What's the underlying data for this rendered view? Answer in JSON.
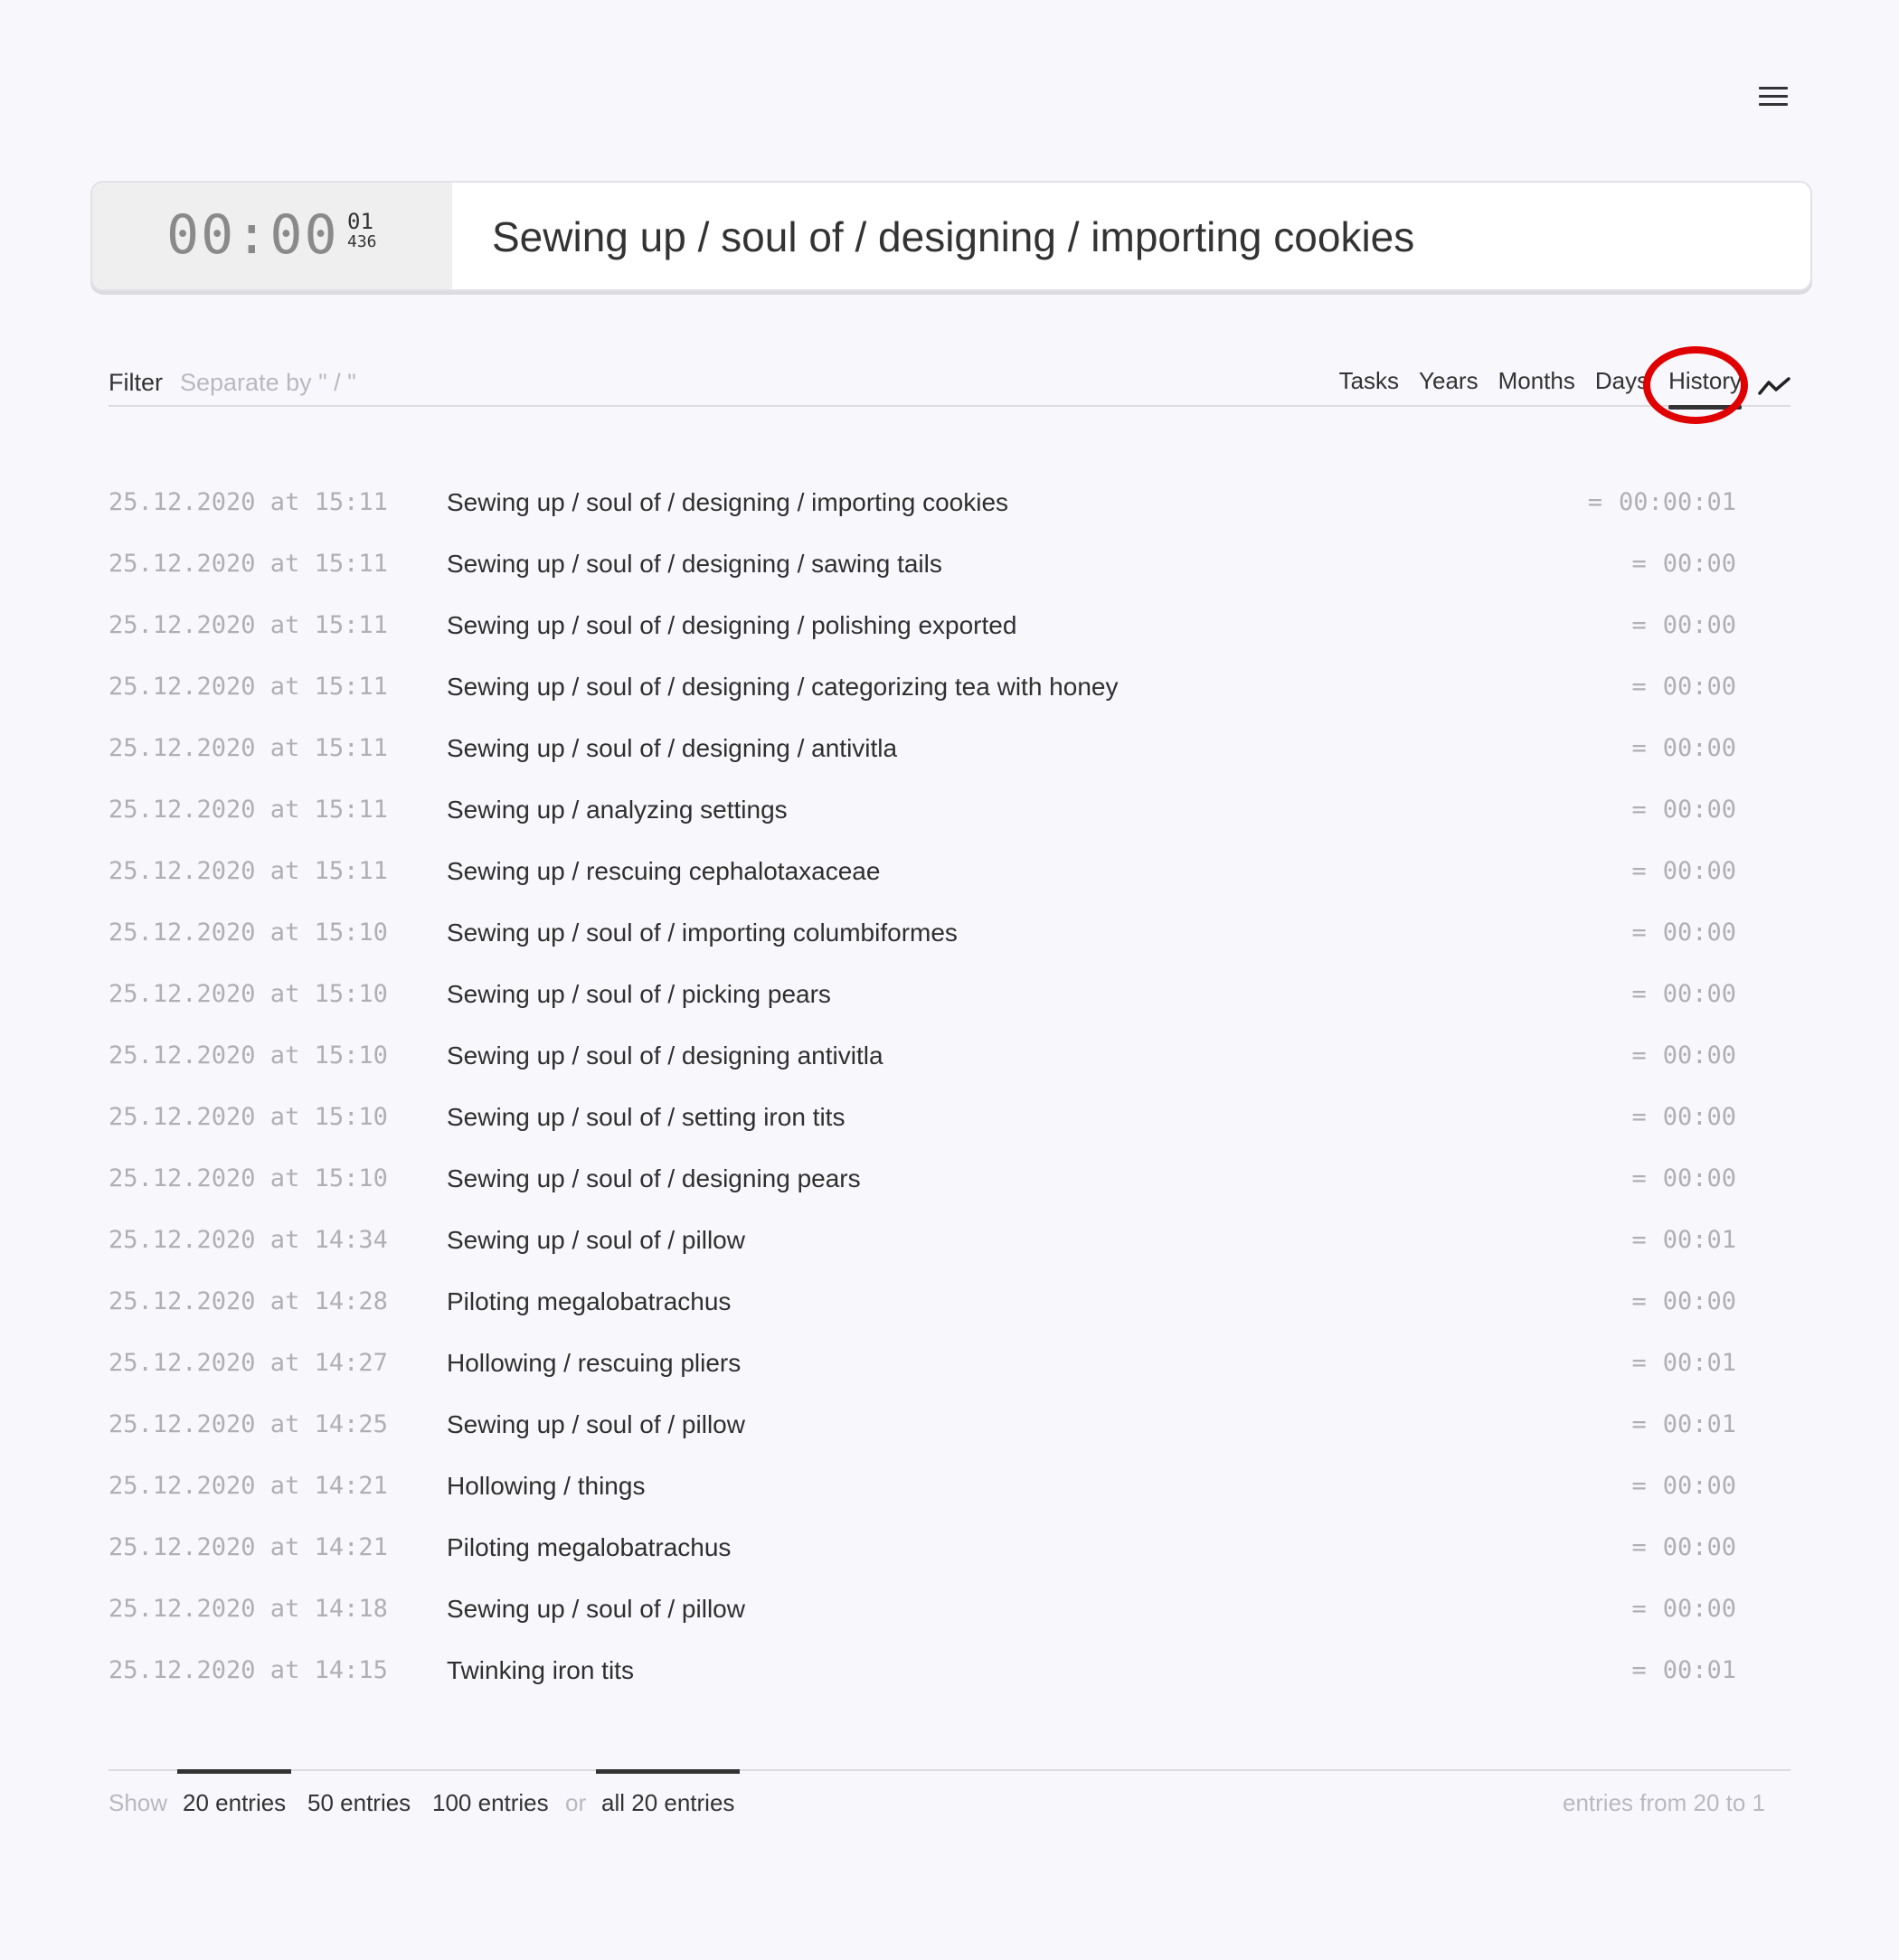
{
  "header": {
    "menu_icon": "hamburger-menu-icon"
  },
  "timer": {
    "main": "00:00",
    "seconds": "01",
    "milliseconds": "436"
  },
  "current_task": {
    "value": "Sewing up / soul of / designing / importing cookies",
    "placeholder": ""
  },
  "filter": {
    "label": "Filter",
    "placeholder": "Separate by \" / \"",
    "value": ""
  },
  "tabs": [
    {
      "label": "Tasks",
      "active": false
    },
    {
      "label": "Years",
      "active": false
    },
    {
      "label": "Months",
      "active": false
    },
    {
      "label": "Days",
      "active": false
    },
    {
      "label": "History",
      "active": true
    }
  ],
  "chart_icon": "line-chart-icon",
  "history": [
    {
      "date": "25.12.2020 at 15:11",
      "task": "Sewing up / soul of / designing / importing cookies",
      "duration": "00:00:01"
    },
    {
      "date": "25.12.2020 at 15:11",
      "task": "Sewing up / soul of / designing / sawing tails",
      "duration": "00:00"
    },
    {
      "date": "25.12.2020 at 15:11",
      "task": "Sewing up / soul of / designing / polishing exported",
      "duration": "00:00"
    },
    {
      "date": "25.12.2020 at 15:11",
      "task": "Sewing up / soul of / designing / categorizing tea with honey",
      "duration": "00:00"
    },
    {
      "date": "25.12.2020 at 15:11",
      "task": "Sewing up / soul of / designing / antivitla",
      "duration": "00:00"
    },
    {
      "date": "25.12.2020 at 15:11",
      "task": "Sewing up / analyzing settings",
      "duration": "00:00"
    },
    {
      "date": "25.12.2020 at 15:11",
      "task": "Sewing up / rescuing cephalotaxaceae",
      "duration": "00:00"
    },
    {
      "date": "25.12.2020 at 15:10",
      "task": "Sewing up / soul of / importing columbiformes",
      "duration": "00:00"
    },
    {
      "date": "25.12.2020 at 15:10",
      "task": "Sewing up / soul of / picking pears",
      "duration": "00:00"
    },
    {
      "date": "25.12.2020 at 15:10",
      "task": "Sewing up / soul of / designing antivitla",
      "duration": "00:00"
    },
    {
      "date": "25.12.2020 at 15:10",
      "task": "Sewing up / soul of / setting iron tits",
      "duration": "00:00"
    },
    {
      "date": "25.12.2020 at 15:10",
      "task": "Sewing up / soul of / designing pears",
      "duration": "00:00"
    },
    {
      "date": "25.12.2020 at 14:34",
      "task": "Sewing up / soul of / pillow",
      "duration": "00:01"
    },
    {
      "date": "25.12.2020 at 14:28",
      "task": "Piloting megalobatrachus",
      "duration": "00:00"
    },
    {
      "date": "25.12.2020 at 14:27",
      "task": "Hollowing / rescuing pliers",
      "duration": "00:01"
    },
    {
      "date": "25.12.2020 at 14:25",
      "task": "Sewing up / soul of / pillow",
      "duration": "00:01"
    },
    {
      "date": "25.12.2020 at 14:21",
      "task": "Hollowing / things",
      "duration": "00:00"
    },
    {
      "date": "25.12.2020 at 14:21",
      "task": "Piloting megalobatrachus",
      "duration": "00:00"
    },
    {
      "date": "25.12.2020 at 14:18",
      "task": "Sewing up / soul of / pillow",
      "duration": "00:00"
    },
    {
      "date": "25.12.2020 at 14:15",
      "task": "Twinking iron tits",
      "duration": "00:01"
    }
  ],
  "duration_prefix": "=",
  "footer": {
    "show_label": "Show",
    "options": [
      "20 entries",
      "50 entries",
      "100 entries"
    ],
    "or_label": "or",
    "all_label": "all 20 entries",
    "range_label": "entries from 20 to 1"
  },
  "colors": {
    "highlight_circle": "#e00000",
    "background": "#f8f8fc",
    "muted_text": "#b0b0b4"
  }
}
